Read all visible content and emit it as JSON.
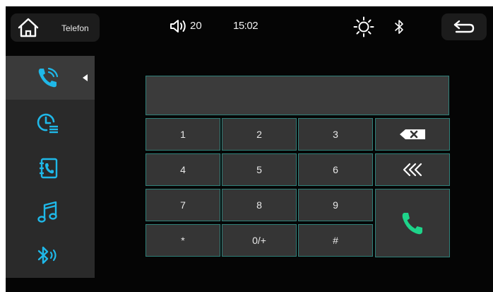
{
  "status_bar": {
    "app_title": "Telefon",
    "volume": "20",
    "time": "15:02"
  },
  "sidebar": {
    "items": [
      {
        "icon": "phone-ringing-icon",
        "active": true
      },
      {
        "icon": "call-history-icon",
        "active": false
      },
      {
        "icon": "phonebook-icon",
        "active": false
      },
      {
        "icon": "music-note-icon",
        "active": false
      },
      {
        "icon": "bluetooth-audio-icon",
        "active": false
      }
    ]
  },
  "dialer": {
    "display_value": "",
    "keys": [
      "1",
      "2",
      "3",
      "4",
      "5",
      "6",
      "7",
      "8",
      "9",
      "*",
      "0/+",
      "#"
    ],
    "backspace_icon": "backspace-icon",
    "clear_icon": "double-chevron-left-icon",
    "call_icon": "call-icon"
  },
  "colors": {
    "accent": "#1fb8e8",
    "call_green": "#1ed48a",
    "key_border": "#2e7f78",
    "key_background": "#353535",
    "screen_background": "#050505"
  }
}
